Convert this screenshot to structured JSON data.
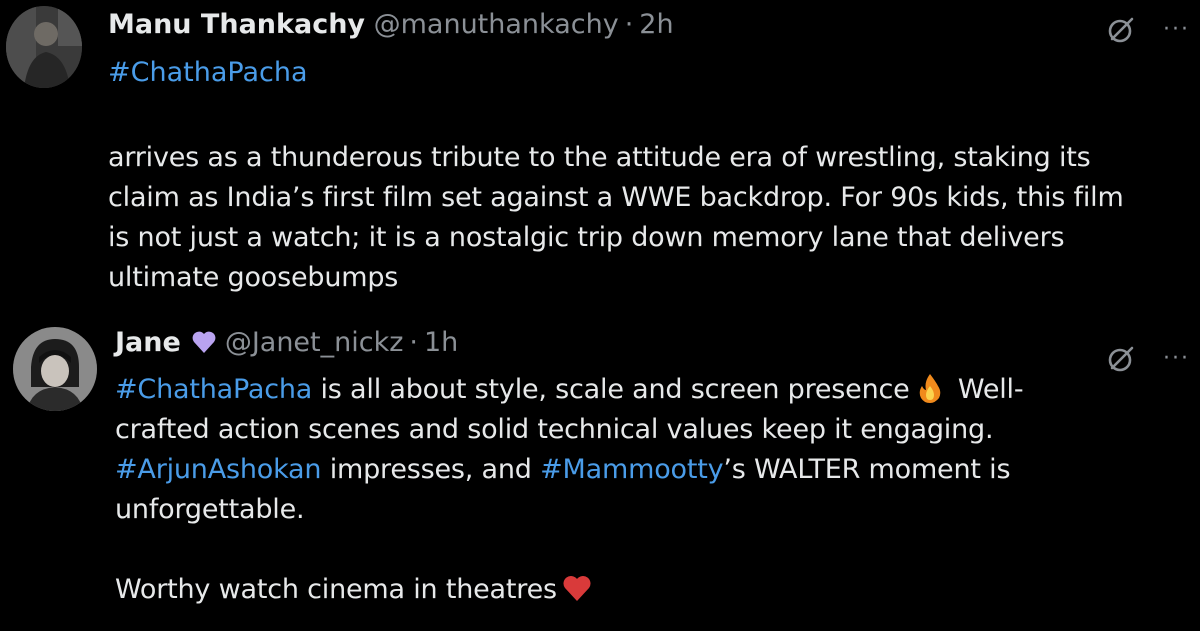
{
  "tweets": [
    {
      "author_name": "Manu Thankachy",
      "handle": "@manuthankachy",
      "separator": "·",
      "time": "2h",
      "hashtag": "#ChathaPacha",
      "body_lines": [
        "arrives as a thunderous tribute to the attitude era of wrestling, staking its",
        "claim as India’s first film set against a WWE backdrop. For 90s kids, this film",
        "is not just a watch; it is a nostalgic trip down memory lane that delivers",
        "ultimate goosebumps"
      ],
      "more": "···"
    },
    {
      "author_name": "Jane",
      "handle": "@Janet_nickz",
      "separator": "·",
      "time": "1h",
      "line1": {
        "tag": "#ChathaPacha",
        "text": " is all about style, scale and screen presence",
        "after_emoji": " Well-"
      },
      "line2": "crafted action scenes and solid technical values keep it engaging.",
      "line3": {
        "tag1": "#ArjunAshokan",
        "text1": " impresses, and ",
        "tag2": "#Mammootty",
        "text2": "’s WALTER moment is"
      },
      "line4": "unforgettable.",
      "line5": "Worthy watch cinema in theatres",
      "more": "···"
    }
  ],
  "colors": {
    "background": "#000000",
    "text": "#e7e9ea",
    "secondary": "#8b9096",
    "link": "#4a9ce8",
    "verified_heart": "#b9a3f0",
    "red_heart": "#d93a3a"
  },
  "icons": [
    "grok-icon",
    "more-icon",
    "purple-heart-icon",
    "fire-emoji-icon",
    "red-heart-icon"
  ]
}
